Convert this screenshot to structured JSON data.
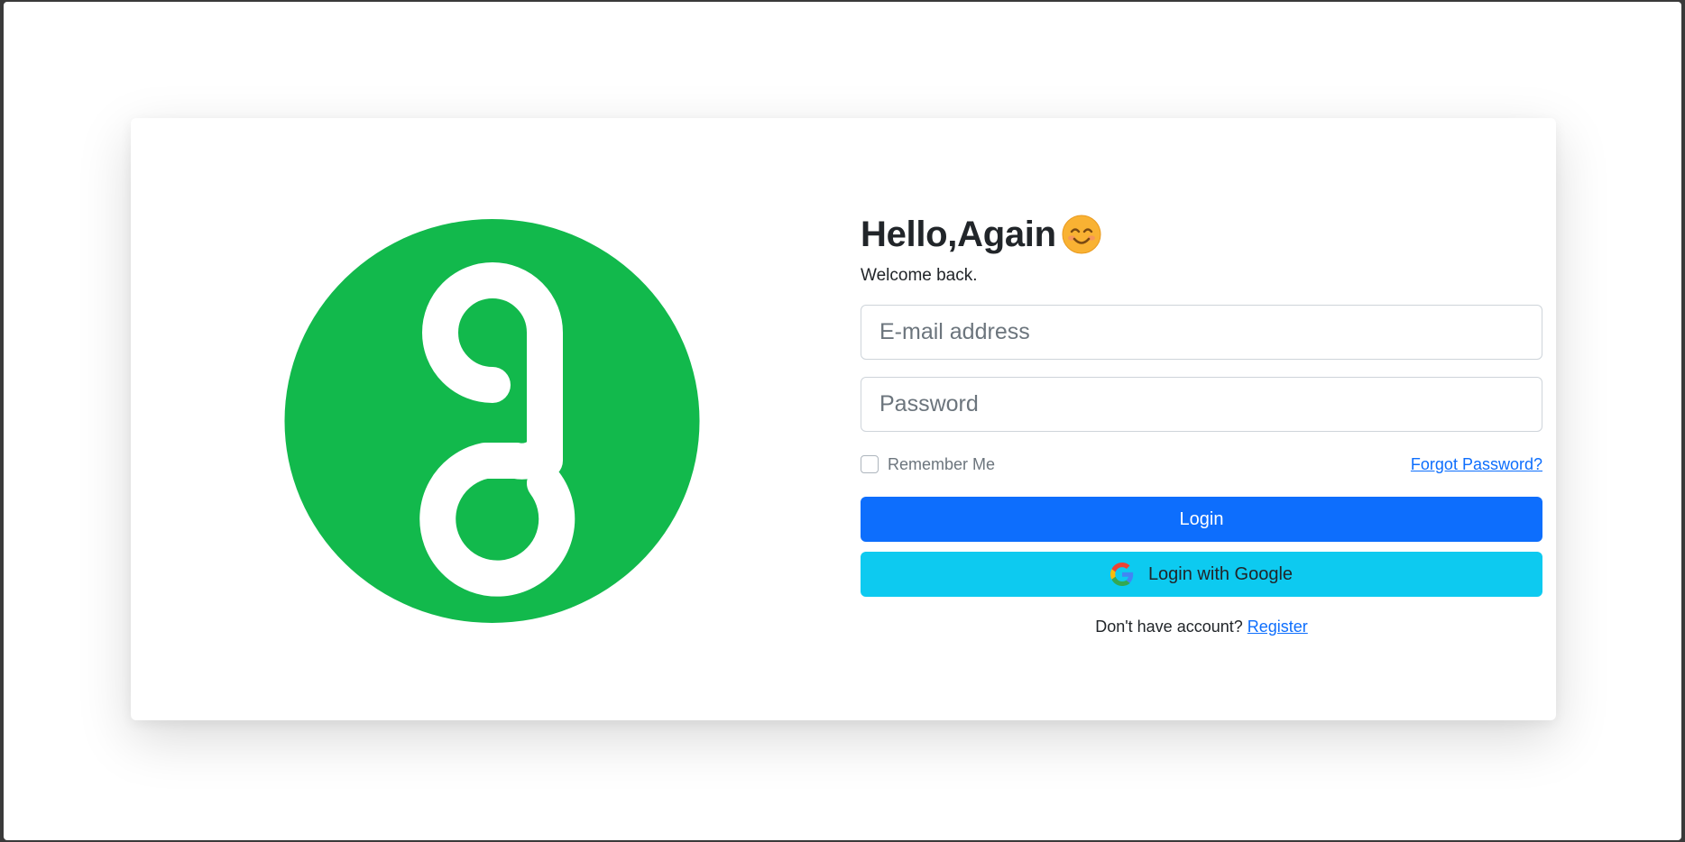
{
  "colors": {
    "brand_green": "#12b94c",
    "primary": "#0d6efd",
    "info": "#0dcaf0"
  },
  "logo": {
    "icon": "brand-g-logo"
  },
  "header": {
    "title": "Hello,Again",
    "emoji_icon": "smiling-face-emoji",
    "subtitle": "Welcome back."
  },
  "form": {
    "email_placeholder": "E-mail address",
    "email_value": "",
    "password_placeholder": "Password",
    "password_value": "",
    "remember_label": "Remember Me",
    "remember_checked": false,
    "forgot_label": "Forgot Password?",
    "login_label": "Login",
    "google_label": "Login with Google",
    "google_icon": "google-icon"
  },
  "footer": {
    "prompt": "Don't have account?",
    "register_label": "Register"
  }
}
